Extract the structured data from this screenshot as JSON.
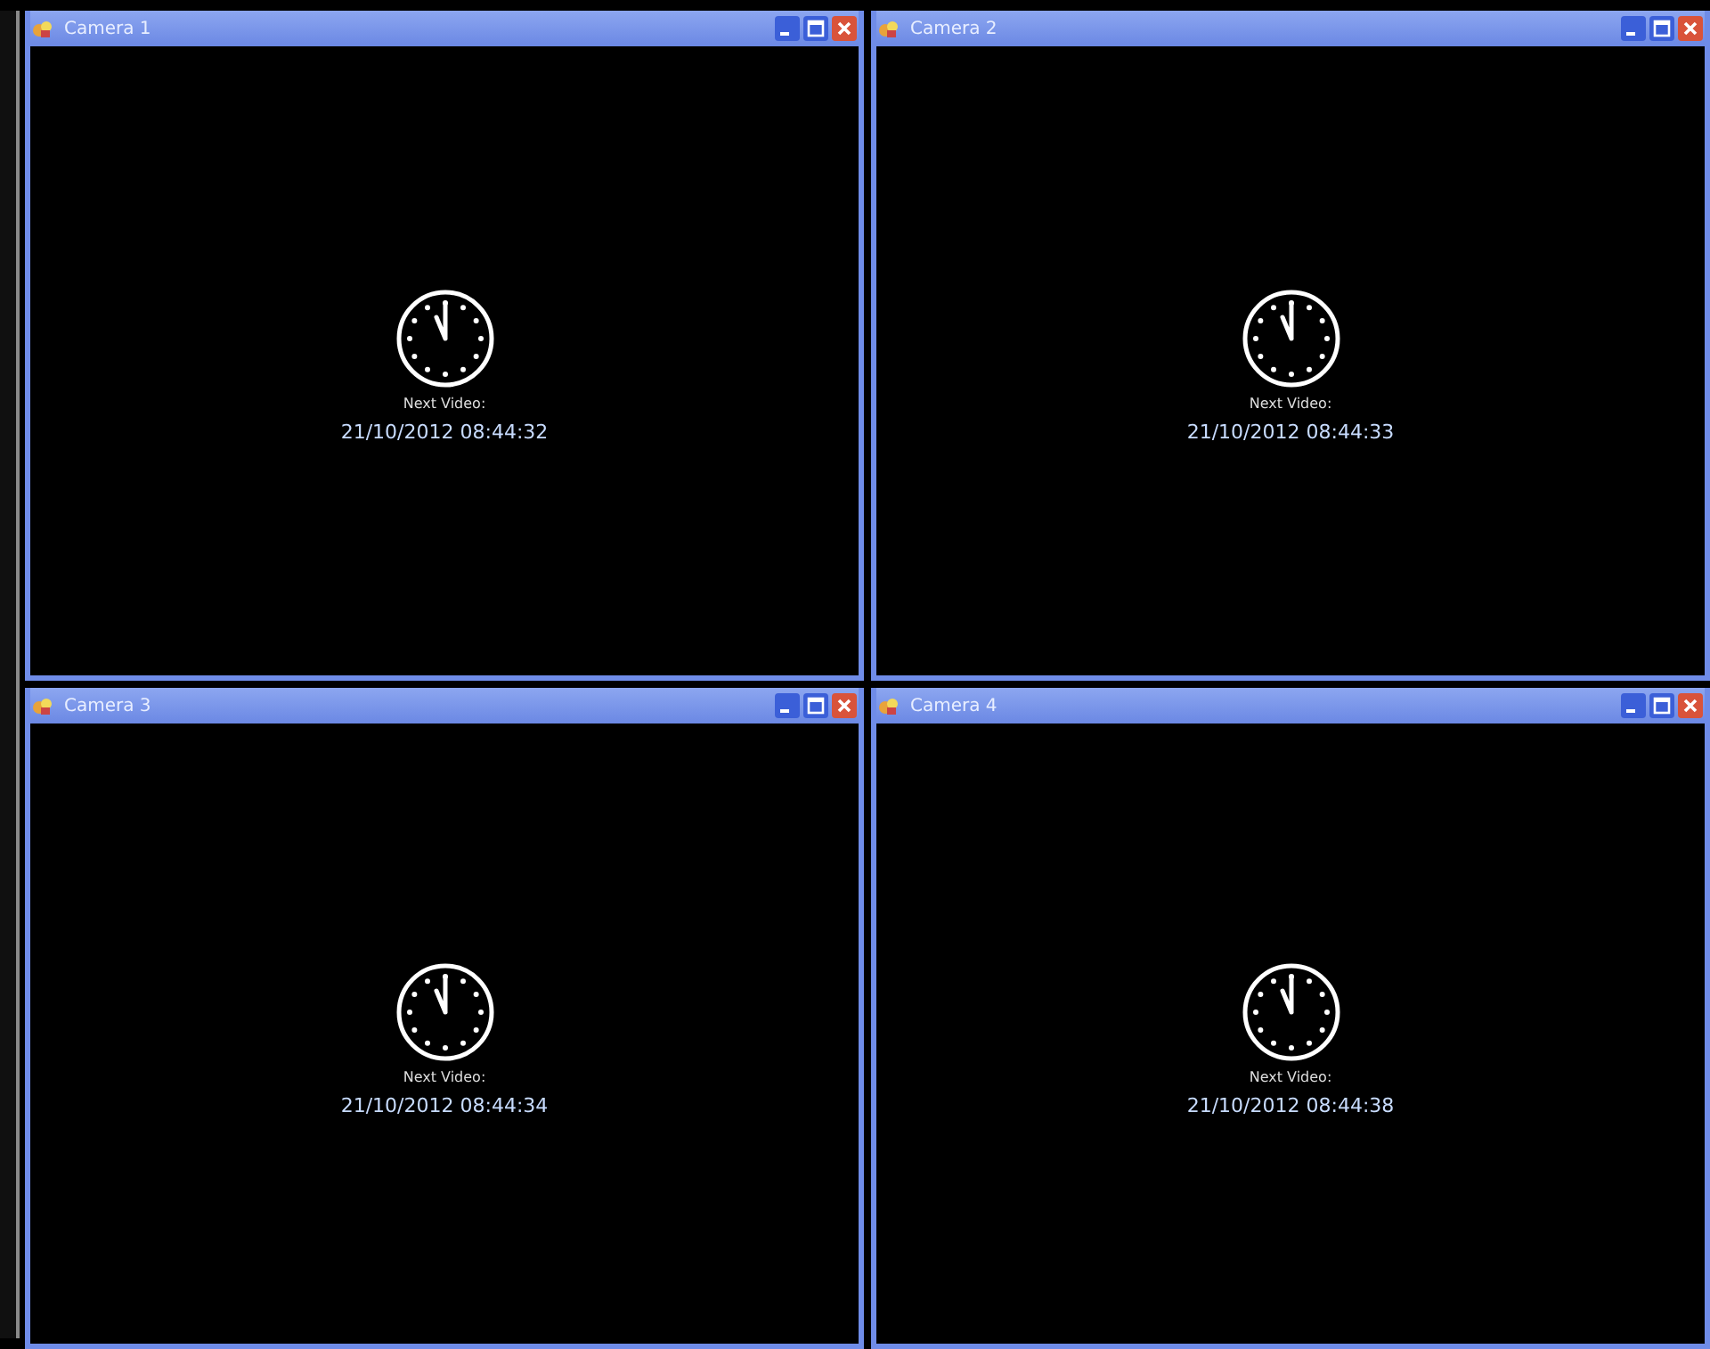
{
  "cameras": [
    {
      "title": "Camera 1",
      "label": "Next Video:",
      "datetime": "21/10/2012 08:44:32"
    },
    {
      "title": "Camera 2",
      "label": "Next Video:",
      "datetime": "21/10/2012 08:44:33"
    },
    {
      "title": "Camera 3",
      "label": "Next Video:",
      "datetime": "21/10/2012 08:44:34"
    },
    {
      "title": "Camera 4",
      "label": "Next Video:",
      "datetime": "21/10/2012 08:44:38"
    }
  ]
}
